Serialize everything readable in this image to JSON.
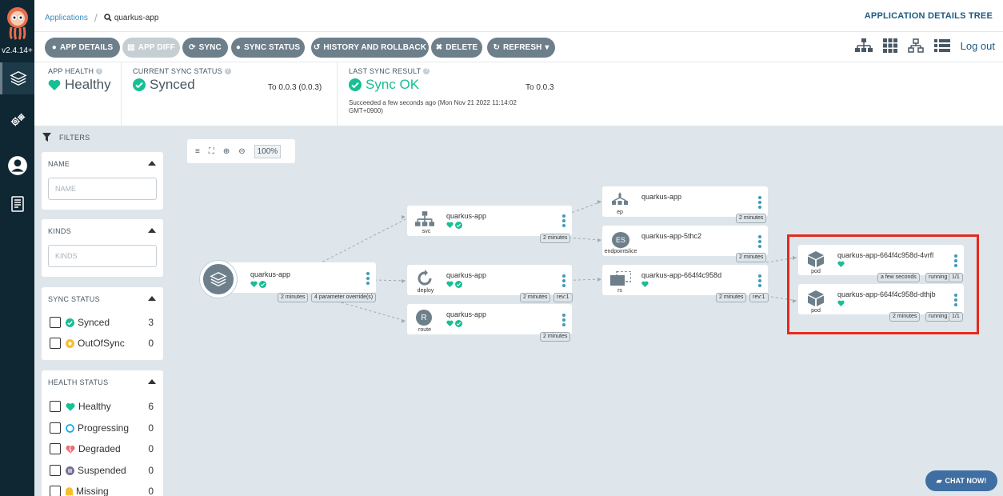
{
  "nav": {
    "version": "v2.4.14+",
    "items": [
      "applications",
      "settings",
      "user-info",
      "documentation"
    ]
  },
  "header": {
    "breadcrumb_root": "Applications",
    "breadcrumb_current": "quarkus-app",
    "view_title": "APPLICATION DETAILS TREE"
  },
  "toolbar": {
    "app_details": "APP DETAILS",
    "app_diff": "APP DIFF",
    "sync": "SYNC",
    "sync_status": "SYNC STATUS",
    "history": "HISTORY AND ROLLBACK",
    "delete": "DELETE",
    "refresh": "REFRESH",
    "logout": "Log out"
  },
  "status": {
    "health_label": "APP HEALTH",
    "health_value": "Healthy",
    "sync_label": "CURRENT SYNC STATUS",
    "sync_value": "Synced",
    "sync_target": "To 0.0.3 (0.0.3)",
    "result_label": "LAST SYNC RESULT",
    "result_value": "Sync OK",
    "result_target": "To 0.0.3",
    "result_detail": "Succeeded a few seconds ago (Mon Nov 21 2022 11:14:02 GMT+0900)"
  },
  "filters": {
    "title": "FILTERS",
    "name": {
      "title": "NAME",
      "placeholder": "NAME"
    },
    "kinds": {
      "title": "KINDS",
      "placeholder": "KINDS"
    },
    "sync": {
      "title": "SYNC STATUS",
      "options": [
        {
          "label": "Synced",
          "count": "3"
        },
        {
          "label": "OutOfSync",
          "count": "0"
        }
      ]
    },
    "health": {
      "title": "HEALTH STATUS",
      "options": [
        {
          "label": "Healthy",
          "count": "6"
        },
        {
          "label": "Progressing",
          "count": "0"
        },
        {
          "label": "Degraded",
          "count": "0"
        },
        {
          "label": "Suspended",
          "count": "0"
        },
        {
          "label": "Missing",
          "count": "0"
        }
      ]
    }
  },
  "zoom": {
    "level": "100%"
  },
  "graph": {
    "app": {
      "name": "quarkus-app",
      "age": "2 minutes",
      "params": "4 parameter override(s)"
    },
    "svc": {
      "name": "quarkus-app",
      "kind": "svc",
      "age": "2 minutes"
    },
    "deploy": {
      "name": "quarkus-app",
      "kind": "deploy",
      "age": "2 minutes",
      "rev": "rev:1"
    },
    "route": {
      "name": "quarkus-app",
      "kind": "route",
      "icon_letter": "R",
      "age": "2 minutes"
    },
    "ep": {
      "name": "quarkus-app",
      "kind": "ep",
      "age": "2 minutes"
    },
    "eps": {
      "name": "quarkus-app-5thc2",
      "kind": "endpointslice",
      "icon_letters": "ES",
      "age": "2 minutes"
    },
    "rs": {
      "name": "quarkus-app-664f4c958d",
      "kind": "rs",
      "age": "2 minutes",
      "rev": "rev:1"
    },
    "pod1": {
      "name": "quarkus-app-664f4c958d-4vrfl",
      "kind": "pod",
      "age": "a few seconds",
      "state": "running",
      "ready": "1/1"
    },
    "pod2": {
      "name": "quarkus-app-664f4c958d-dthjb",
      "kind": "pod",
      "age": "2 minutes",
      "state": "running",
      "ready": "1/1"
    }
  },
  "chat": {
    "label": "CHAT NOW!"
  },
  "colors": {
    "healthy": "#18be94",
    "accent": "#3f9ab8",
    "nav_bg": "#0f2733",
    "highlight": "#e32a1f"
  }
}
